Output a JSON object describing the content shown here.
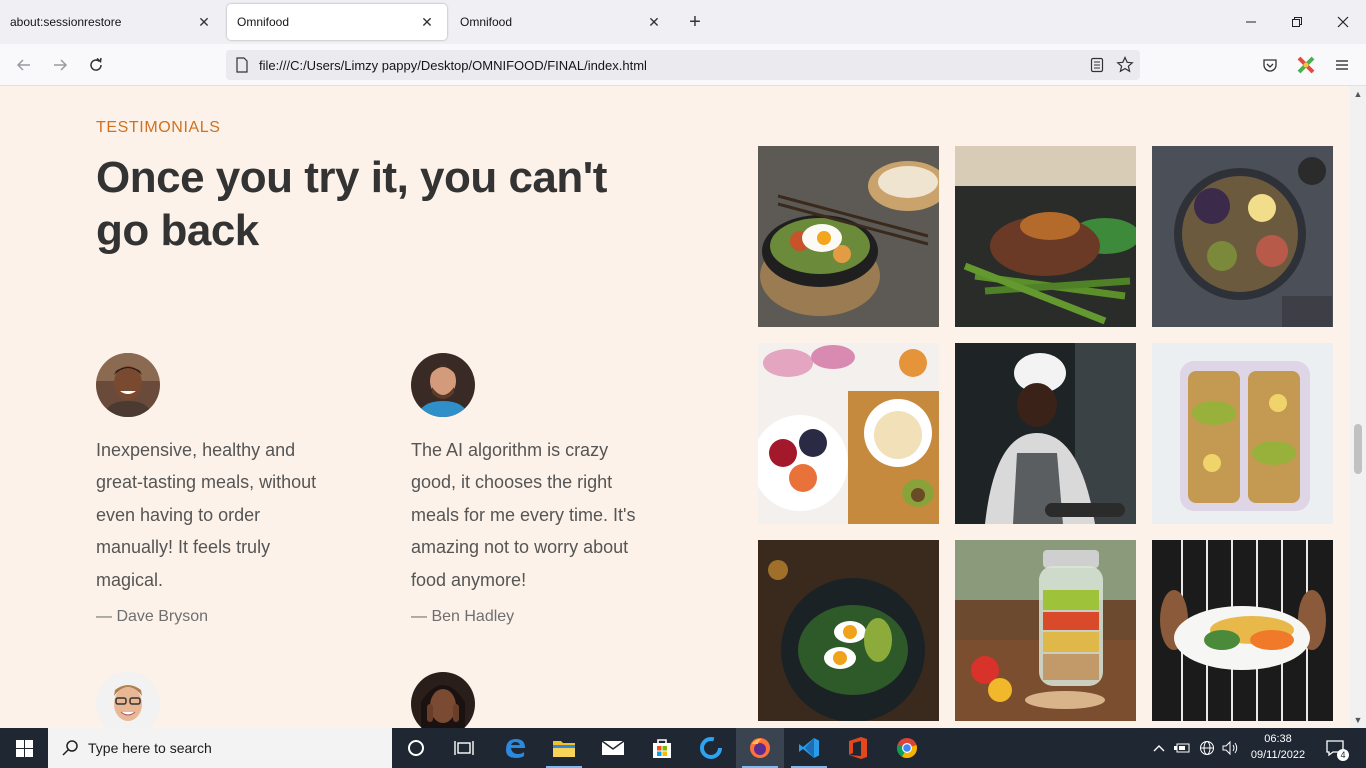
{
  "browser": {
    "tabs": [
      {
        "title": "about:sessionrestore",
        "active": false
      },
      {
        "title": "Omnifood",
        "active": true
      },
      {
        "title": "Omnifood",
        "active": false
      }
    ],
    "url": "file:///C:/Users/Limzy pappy/Desktop/OMNIFOOD/FINAL/index.html"
  },
  "page": {
    "subheading": "TESTIMONIALS",
    "heading": "Once you try it, you can't go back",
    "testimonials": [
      {
        "quote": "Inexpensive, healthy and great-tasting meals, without even having to order manually! It feels truly magical.",
        "author": "— Dave Bryson"
      },
      {
        "quote": "The AI algorithm is crazy good, it chooses the right meals for me every time. It's amazing not to worry about food anymore!",
        "author": "— Ben Hadley"
      },
      {
        "quote": "",
        "author": ""
      },
      {
        "quote": "",
        "author": ""
      }
    ]
  },
  "taskbar": {
    "search_placeholder": "Type here to search",
    "time": "06:38",
    "date": "09/11/2022",
    "notification_count": "4"
  },
  "colors": {
    "page_background": "#fdf2e9",
    "subheading": "#cf711f",
    "heading": "#333333",
    "taskbar": "#1f2733"
  }
}
